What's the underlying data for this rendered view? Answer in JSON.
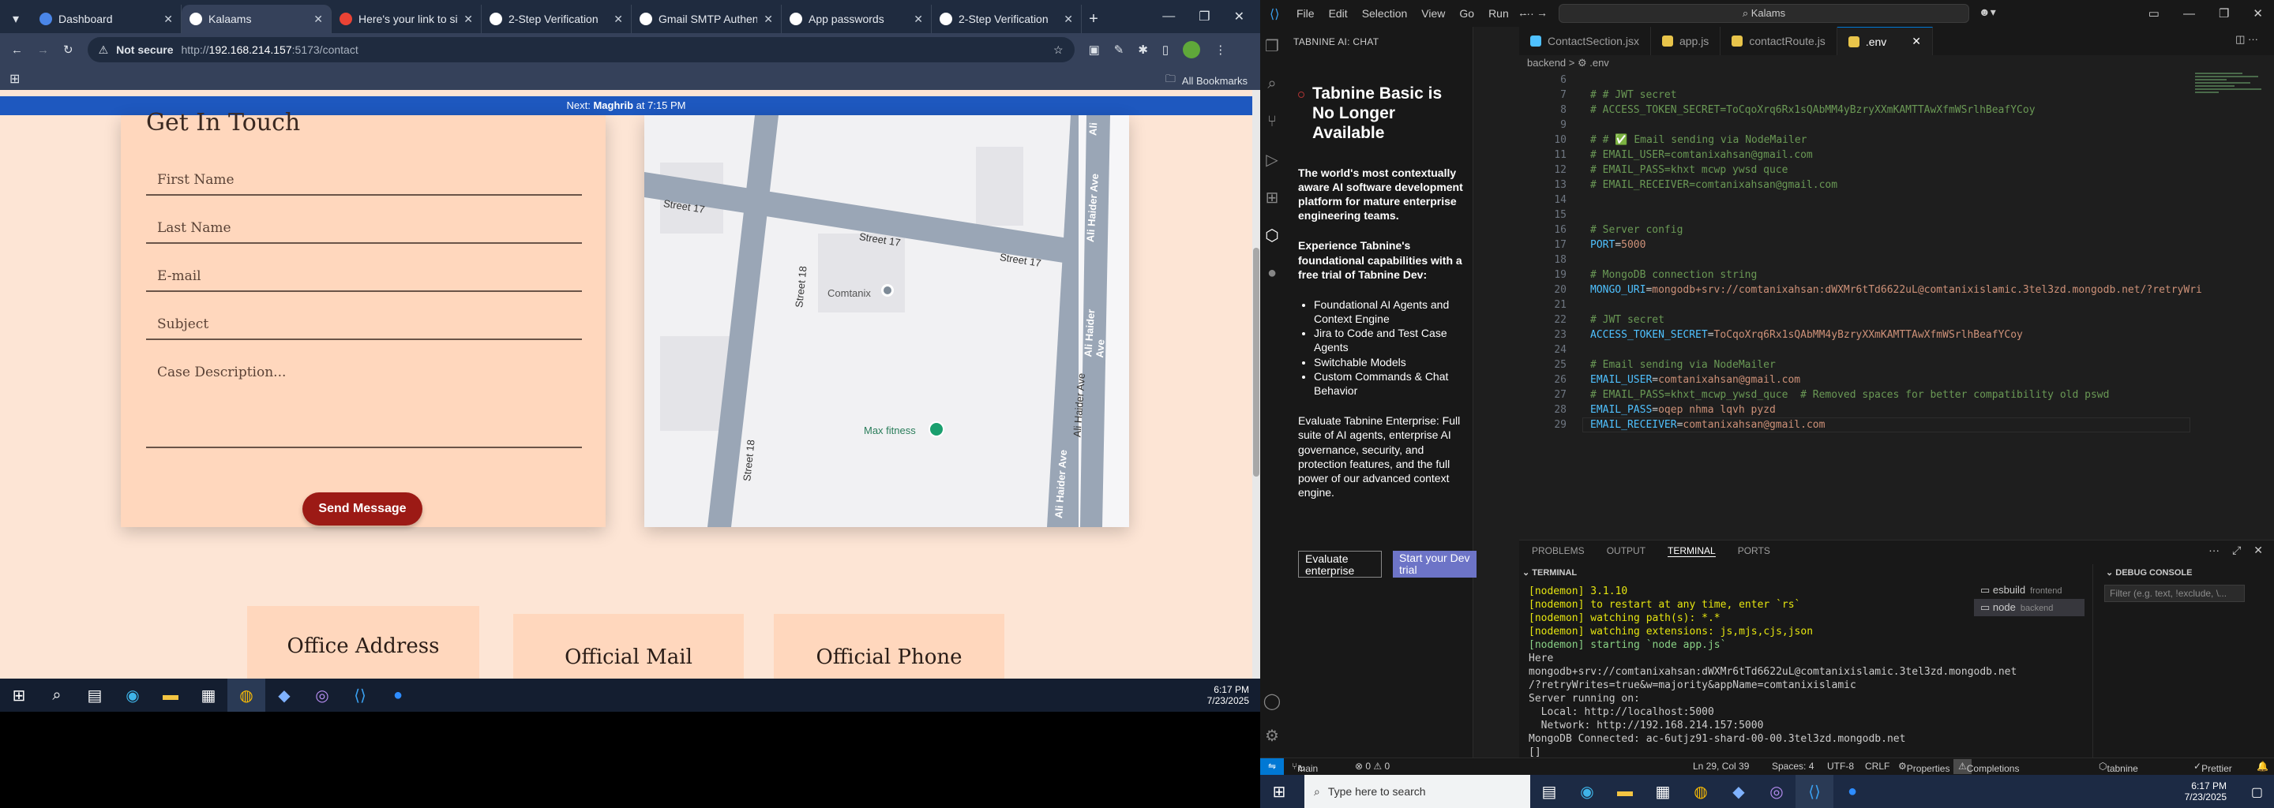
{
  "browser": {
    "tabs": [
      {
        "title": "Dashboard",
        "color": "#4a86e8"
      },
      {
        "title": "Kalaams",
        "color": "#ffffff"
      },
      {
        "title": "Here's your link to sig",
        "color": "#ea4335"
      },
      {
        "title": "2-Step Verification",
        "color": "#ffffff"
      },
      {
        "title": "Gmail SMTP Authentic",
        "color": "#ffffff"
      },
      {
        "title": "App passwords",
        "color": "#ffffff"
      },
      {
        "title": "2-Step Verification",
        "color": "#ffffff"
      }
    ],
    "not_secure": "Not secure",
    "url_prefix": "http://",
    "url_host": "192.168.214.157",
    "url_path": ":5173/contact",
    "bookmarks_all": "All Bookmarks"
  },
  "page": {
    "notice_prefix": "Next: ",
    "notice_bold": "Maghrib",
    "notice_suffix": " at 7:15 PM",
    "form_title": "Get In Touch",
    "fields": {
      "first_name": "First Name",
      "last_name": "Last Name",
      "email": "E-mail",
      "subject": "Subject",
      "description": "Case Description..."
    },
    "send_button": "Send Message",
    "map": {
      "street1": "Street 17",
      "street2": "Street 17",
      "street3": "Street 17",
      "street18a": "Street 18",
      "street18b": "Street 18",
      "ave1": "Ali Haider Ave",
      "ave2": "Ali Haider Ave",
      "ave3": "Ali Haider Ave",
      "ave4": "Ali Haider Ave",
      "ave_top": "Ali",
      "poi1": "Comtanix",
      "poi2": "Max fitness"
    },
    "cards": {
      "office": "Office Address",
      "mail": "Official Mail",
      "phone": "Official Phone"
    }
  },
  "taskbar_left": {
    "time": "6:17 PM",
    "date": "7/23/2025"
  },
  "vscode": {
    "menu": [
      "File",
      "Edit",
      "Selection",
      "View",
      "Go",
      "Run",
      "···"
    ],
    "search": "Kalams",
    "chat": {
      "header": "TABNINE AI: CHAT",
      "title": "Tabnine Basic is No Longer Available",
      "p1": "The world's most contextually aware AI software development platform for mature enterprise engineering teams.",
      "p2": "Experience Tabnine's foundational capabilities with a free trial of Tabnine Dev:",
      "bullets": [
        "Foundational AI Agents and Context Engine",
        "Jira to Code and Test Case Agents",
        "Switchable Models",
        "Custom Commands & Chat Behavior"
      ],
      "p3": "Evaluate Tabnine Enterprise: Full suite of AI agents, enterprise AI governance, security, and protection features, and the full power of our advanced context engine.",
      "btn1": "Evaluate enterprise",
      "btn2": "Start your Dev trial"
    },
    "editor_tabs": [
      "ContactSection.jsx",
      "app.js",
      "contactRoute.js",
      ".env"
    ],
    "breadcrumb": "backend > ⚙ .env",
    "code": [
      {
        "n": "6",
        "t": "",
        "cls": "w"
      },
      {
        "n": "7",
        "t": "# # JWT secret",
        "cls": "c"
      },
      {
        "n": "8",
        "t": "# ACCESS_TOKEN_SECRET=ToCqoXrq6Rx1sQAbMM4yBzryXXmKAMTTAwXfmWSrlhBeafYCoy",
        "cls": "c"
      },
      {
        "n": "9",
        "t": "",
        "cls": "w"
      },
      {
        "n": "10",
        "t": "# # ✅ Email sending via NodeMailer",
        "cls": "c"
      },
      {
        "n": "11",
        "t": "# EMAIL_USER=comtanixahsan@gmail.com",
        "cls": "c"
      },
      {
        "n": "12",
        "t": "# EMAIL_PASS=khxt mcwp ywsd quce",
        "cls": "c"
      },
      {
        "n": "13",
        "t": "# EMAIL_RECEIVER=comtanixahsan@gmail.com",
        "cls": "c"
      },
      {
        "n": "14",
        "t": "",
        "cls": "w"
      },
      {
        "n": "15",
        "t": "",
        "cls": "w"
      },
      {
        "n": "16",
        "t": "# Server config",
        "cls": "c"
      },
      {
        "n": "17",
        "k": "PORT",
        "v": "5000"
      },
      {
        "n": "18",
        "t": "",
        "cls": "w"
      },
      {
        "n": "19",
        "t": "# MongoDB connection string",
        "cls": "c"
      },
      {
        "n": "20",
        "k": "MONGO_URI",
        "v": "mongodb+srv://comtanixahsan:dWXMr6tTd6622uL@comtanixislamic.3tel3zd.mongodb.net/?retryWri"
      },
      {
        "n": "21",
        "t": "",
        "cls": "w"
      },
      {
        "n": "22",
        "t": "# JWT secret",
        "cls": "c"
      },
      {
        "n": "23",
        "k": "ACCESS_TOKEN_SECRET",
        "v": "ToCqoXrq6Rx1sQAbMM4yBzryXXmKAMTTAwXfmWSrlhBeafYCoy"
      },
      {
        "n": "24",
        "t": "",
        "cls": "w"
      },
      {
        "n": "25",
        "t": "# Email sending via NodeMailer",
        "cls": "c"
      },
      {
        "n": "26",
        "k": "EMAIL_USER",
        "v": "comtanixahsan@gmail.com"
      },
      {
        "n": "27",
        "t": "# EMAIL_PASS=khxt_mcwp_ywsd_quce  # Removed spaces for better compatibility old pswd",
        "cls": "c"
      },
      {
        "n": "28",
        "k": "EMAIL_PASS",
        "v": "oqep nhma lqvh pyzd"
      },
      {
        "n": "29",
        "k": "EMAIL_RECEIVER",
        "v": "comtanixahsan@gmail.com"
      }
    ],
    "panel_tabs": [
      "PROBLEMS",
      "OUTPUT",
      "TERMINAL",
      "PORTS"
    ],
    "terminal_label": "TERMINAL",
    "terminal_lines": [
      {
        "t": "[nodemon] 3.1.10",
        "cls": "y"
      },
      {
        "t": "[nodemon] to restart at any time, enter `rs`",
        "cls": "y"
      },
      {
        "t": "[nodemon] watching path(s): *.*",
        "cls": "y"
      },
      {
        "t": "[nodemon] watching extensions: js,mjs,cjs,json",
        "cls": "y"
      },
      {
        "t": "[nodemon] starting `node app.js`",
        "cls": "g"
      },
      {
        "t": "Here",
        "cls": "w"
      },
      {
        "t": "mongodb+srv://comtanixahsan:dWXMr6tTd6622uL@comtanixislamic.3tel3zd.mongodb.net",
        "cls": "w"
      },
      {
        "t": "/?retryWrites=true&w=majority&appName=comtanixislamic",
        "cls": "w"
      },
      {
        "t": "Server running on:",
        "cls": "w"
      },
      {
        "t": "  Local: http://localhost:5000",
        "cls": "w"
      },
      {
        "t": "  Network: http://192.168.214.157:5000",
        "cls": "w"
      },
      {
        "t": "MongoDB Connected: ac-6utjz91-shard-00-00.3tel3zd.mongodb.net",
        "cls": "w"
      },
      {
        "t": "[]",
        "cls": "w"
      }
    ],
    "term_list": [
      {
        "name": "esbuild",
        "tag": "frontend"
      },
      {
        "name": "node",
        "tag": "backend"
      }
    ],
    "debug_label": "DEBUG CONSOLE",
    "debug_filter": "Filter (e.g. text, !exclude, \\...",
    "status": {
      "branch": "main",
      "sync": "↻",
      "problems": "⊗ 0 ⚠ 0",
      "position": "Ln 29, Col 39",
      "spaces": "Spaces: 4",
      "encoding": "UTF-8",
      "eol": "CRLF",
      "properties": "Properties",
      "quota": "Completions quota reached",
      "tabnine": "tabnine basic",
      "prettier": "Prettier"
    }
  },
  "taskbar_right": {
    "search": "Type here to search",
    "time": "6:17 PM",
    "date": "7/23/2025"
  }
}
